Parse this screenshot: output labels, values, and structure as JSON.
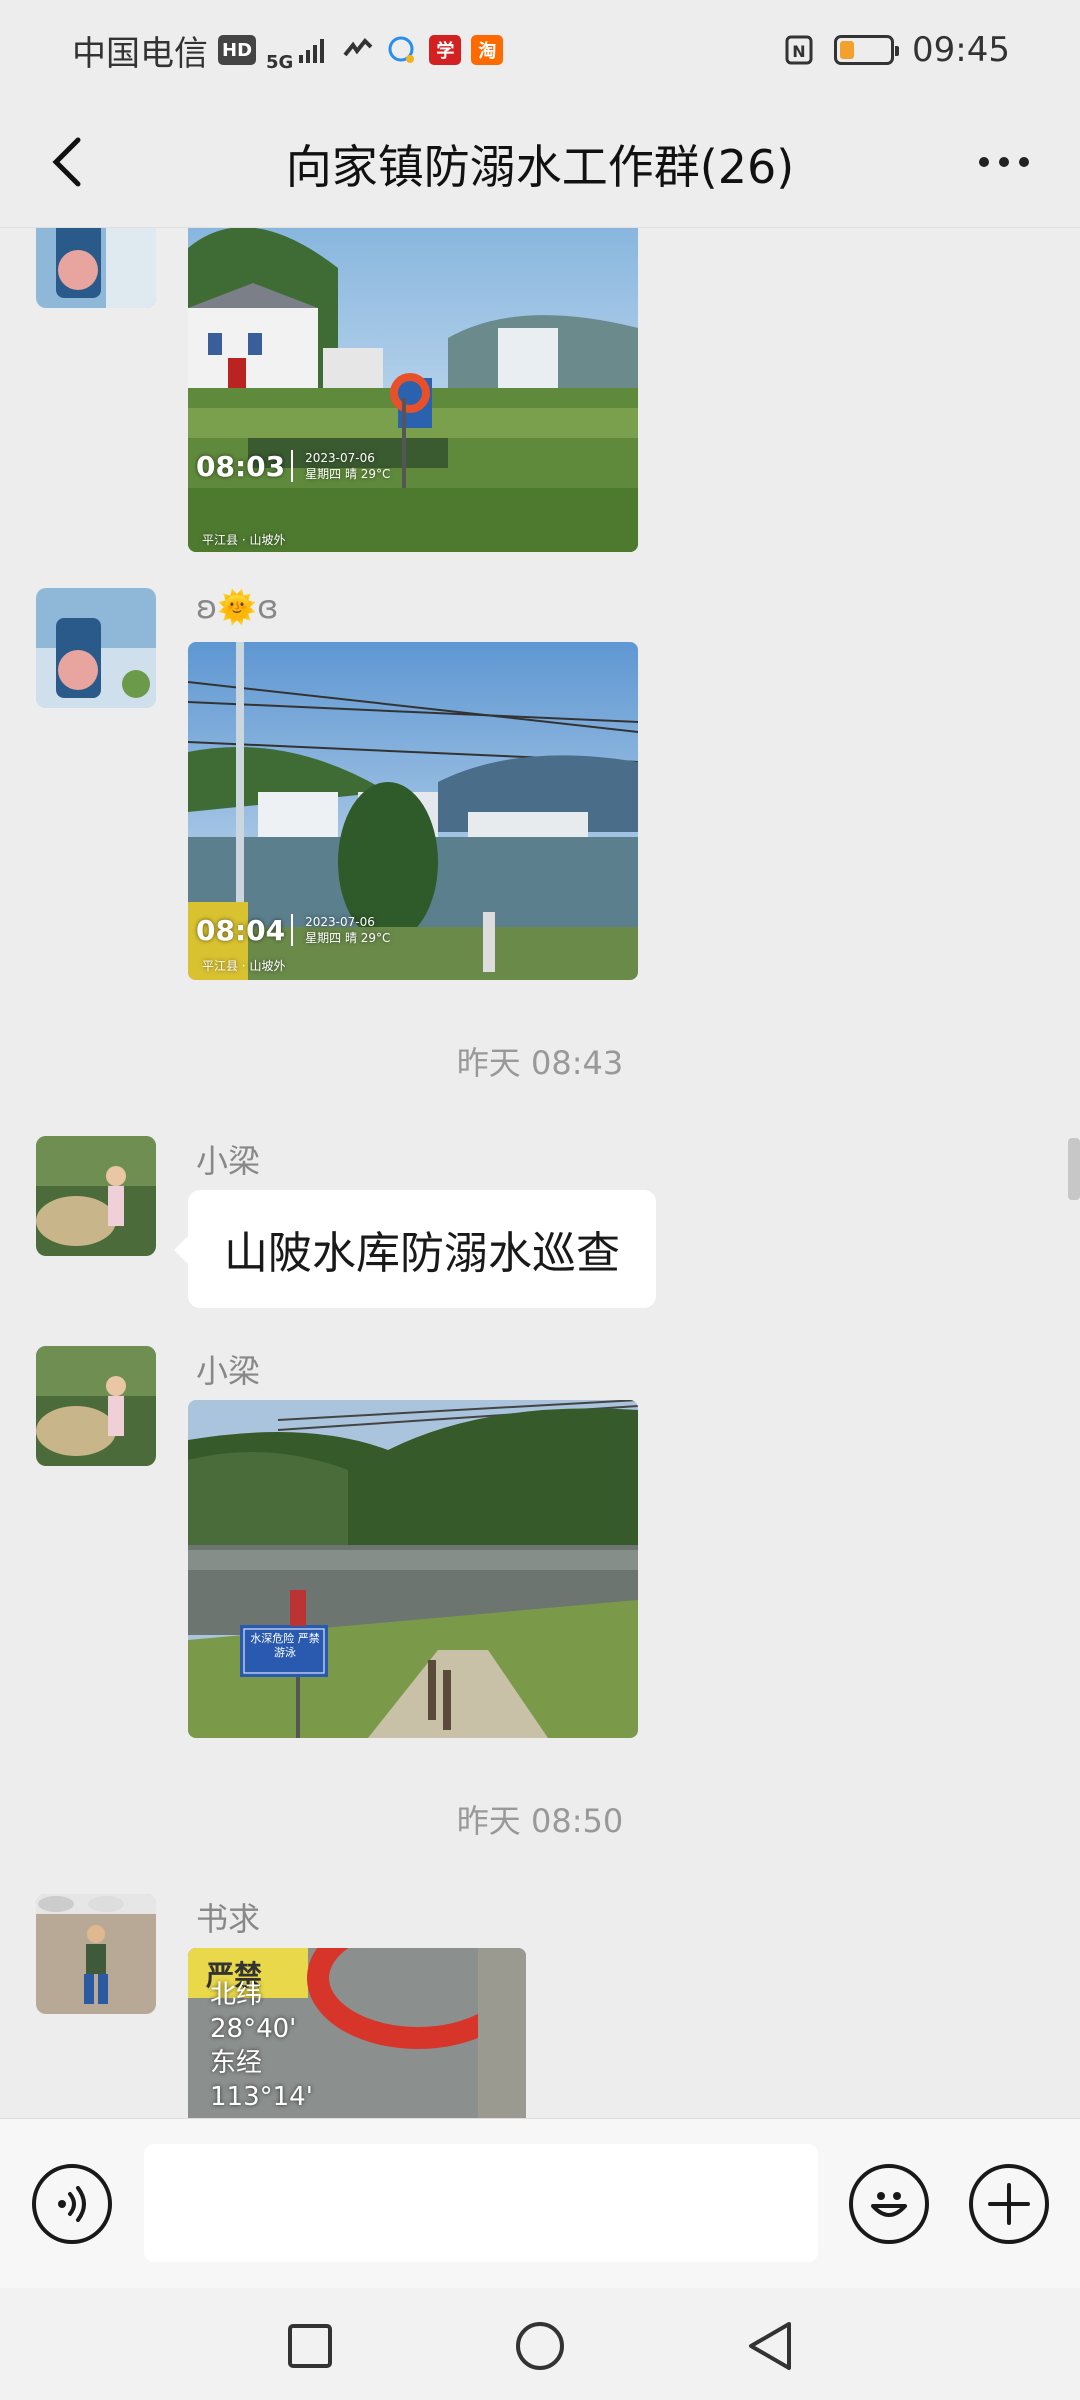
{
  "status_bar": {
    "carrier": "中国电信",
    "hd_badge": "HD",
    "network": "5G",
    "app_icon_1": "学",
    "app_icon_2": "淘",
    "time": "09:45",
    "battery_level": 0.25,
    "icons": [
      "signal-icon",
      "wifi-calling-icon",
      "chat-app-icon",
      "nfc-icon",
      "battery-icon"
    ]
  },
  "header": {
    "title": "向家镇防溺水工作群(26)"
  },
  "messages": [
    {
      "type": "image",
      "stamp_time": "08:03",
      "stamp_date": "2023-07-06",
      "stamp_weather": "星期四 晴 29°C",
      "stamp_place": "平江县 · 山坡外"
    },
    {
      "type": "image",
      "sender": "ʚ🌞ɞ",
      "stamp_time": "08:04",
      "stamp_date": "2023-07-06",
      "stamp_weather": "星期四 晴 29°C",
      "stamp_place": "平江县 · 山坡外"
    },
    {
      "type": "time",
      "text": "昨天 08:43"
    },
    {
      "type": "text",
      "sender": "小梁",
      "text": "山陂水库防溺水巡查"
    },
    {
      "type": "image",
      "sender": "小梁",
      "sign_text": "水深危险 严禁游泳"
    },
    {
      "type": "time",
      "text": "昨天 08:50"
    },
    {
      "type": "image",
      "sender": "书求",
      "gps_lines": [
        "北纬",
        "28°40'",
        "东经",
        "113°14'"
      ],
      "sign_text": "严禁"
    }
  ],
  "input_bar": {
    "voice_icon": "voice-icon",
    "emoji_icon": "emoji-icon",
    "plus_icon": "plus-icon",
    "placeholder": ""
  },
  "system_nav": [
    "recents-square-icon",
    "home-circle-icon",
    "back-triangle-icon"
  ],
  "colors": {
    "background": "#ededed",
    "bubble": "#ffffff",
    "battery": "#f2a12d",
    "text_secondary": "#888888"
  }
}
